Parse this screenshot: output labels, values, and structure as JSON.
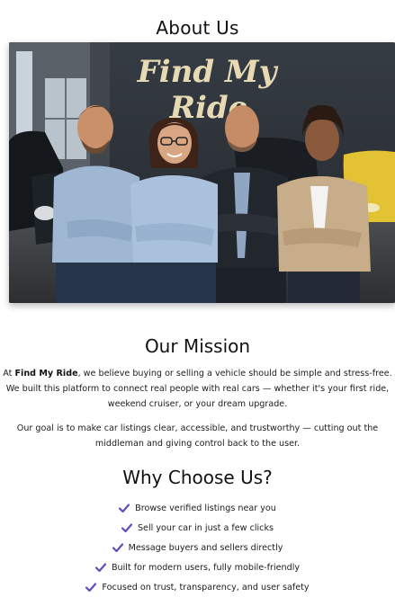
{
  "page": {
    "title": "About Us"
  },
  "hero": {
    "sign_text_line1": "Find My",
    "sign_text_line2": "Ride",
    "description": "Team photo of four people standing in a car showroom"
  },
  "mission": {
    "title": "Our Mission",
    "paragraph1": {
      "prefix": "At ",
      "brand": "Find My Ride",
      "line1_rest": ", we believe buying or selling a vehicle should be simple and stress-free.",
      "line2": "We built this platform to connect real people with real cars — whether it's your first ride,",
      "line3": "weekend cruiser, or your dream upgrade."
    },
    "paragraph2": {
      "line1": "Our goal is to make car listings clear, accessible, and trustworthy — cutting out the",
      "line2": "middleman and giving control back to the user."
    }
  },
  "why": {
    "title": "Why Choose Us?",
    "items": [
      "Browse verified listings near you",
      "Sell your car in just a few clicks",
      "Message buyers and sellers directly",
      "Built for modern users, fully mobile-friendly",
      "Focused on trust, transparency, and user safety"
    ],
    "check_color": "#5b4fbf"
  }
}
